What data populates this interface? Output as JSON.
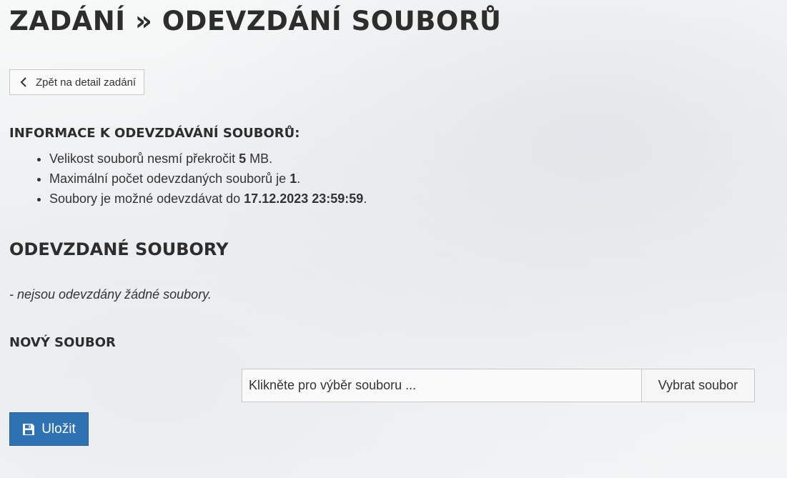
{
  "page": {
    "title": "ZADÁNÍ » ODEVZDÁNÍ SOUBORŮ"
  },
  "back_button": {
    "label": "Zpět na detail zadání",
    "icon": "chevron-left-icon"
  },
  "info": {
    "heading": "INFORMACE K ODEVZDÁVÁNÍ SOUBORŮ:",
    "items": [
      {
        "before": "Velikost souborů nesmí překročit ",
        "value": "5",
        "after": " MB."
      },
      {
        "before": "Maximální počet odevzdaných souborů je ",
        "value": "1",
        "after": "."
      },
      {
        "before": "Soubory je možné odevzdávat do ",
        "value": "17.12.2023 23:59:59",
        "after": "."
      }
    ]
  },
  "submitted": {
    "heading": "ODEVZDANÉ SOUBORY",
    "empty_text": "- nejsou odevzdány žádné soubory."
  },
  "new_file": {
    "heading": "NOVÝ SOUBOR",
    "placeholder": "Klikněte pro výběr souboru ...",
    "choose_label": "Vybrat soubor"
  },
  "save_button": {
    "label": "Uložit",
    "icon": "floppy-disk-icon",
    "color": "#2f72b3"
  }
}
